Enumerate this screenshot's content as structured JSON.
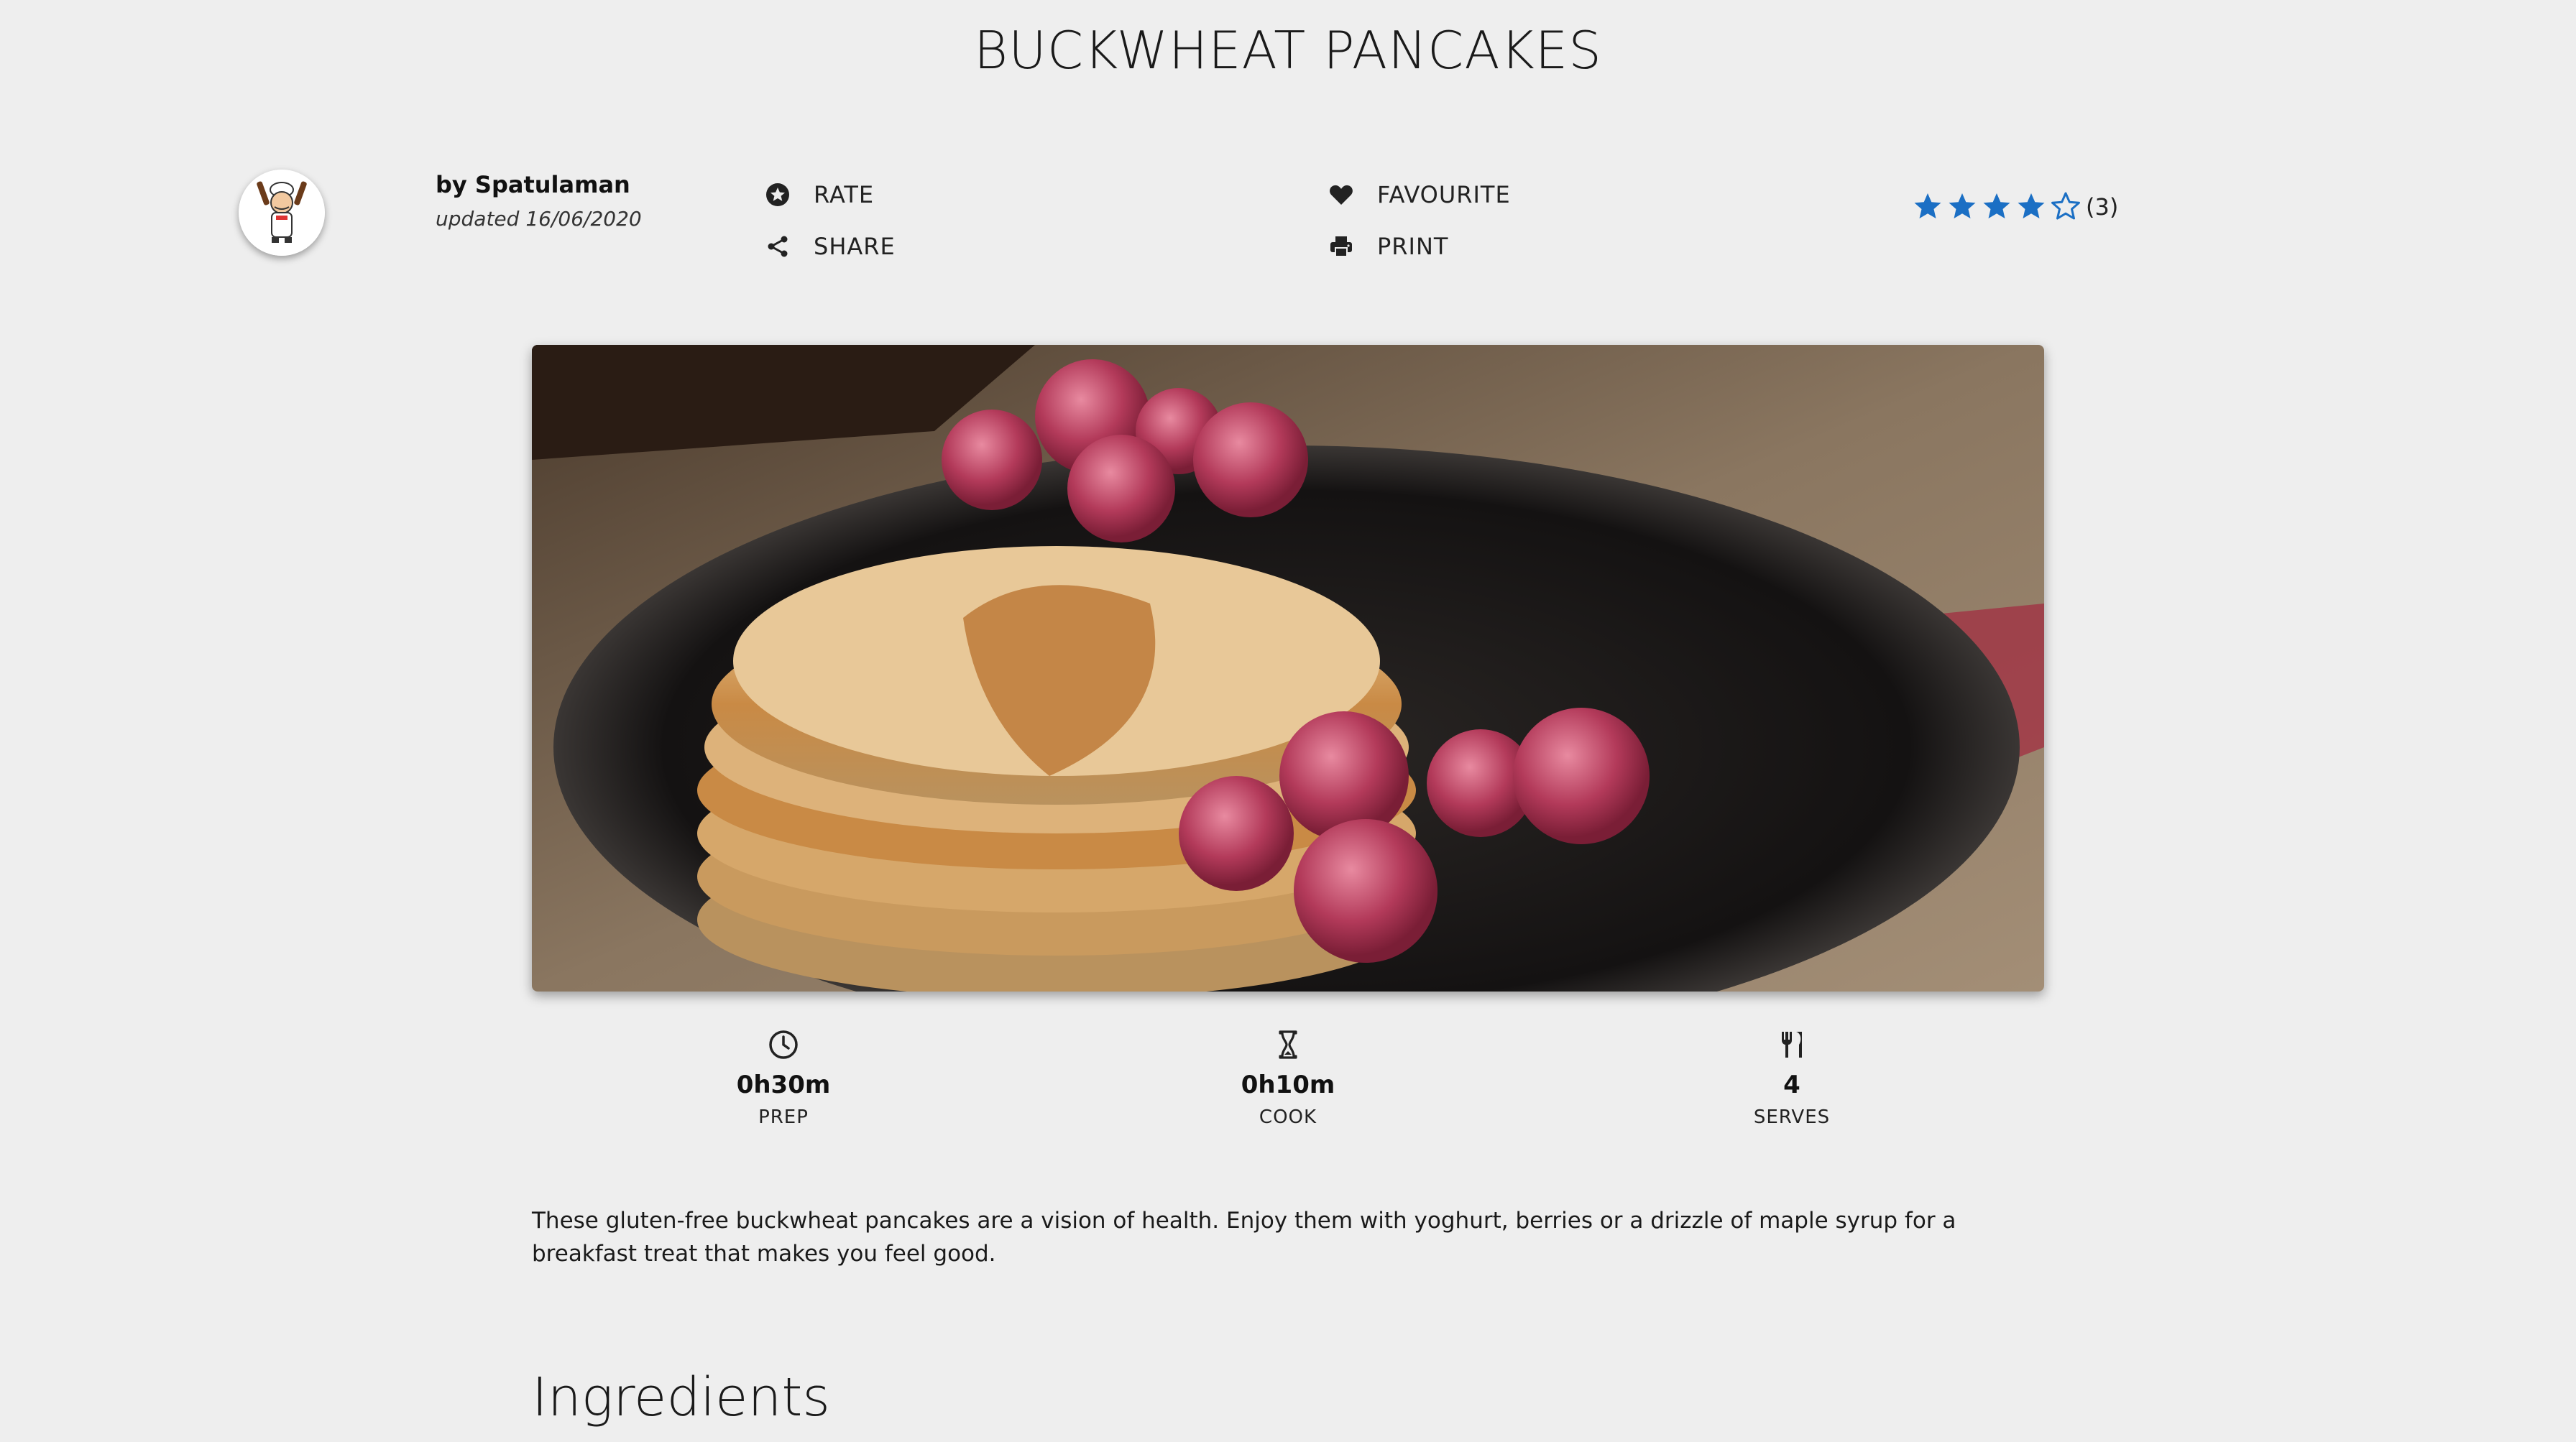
{
  "recipe": {
    "title": "BUCKWHEAT PANCAKES",
    "author": "by Spatulaman",
    "updated": "updated 16/06/2020",
    "description": "These gluten-free buckwheat pancakes are a vision of health. Enjoy them with yoghurt, berries or a drizzle of maple syrup for a breakfast treat that makes you feel good."
  },
  "actions": {
    "rate": "RATE",
    "share": "SHARE",
    "favourite": "FAVOURITE",
    "print": "PRINT"
  },
  "rating": {
    "value": 4,
    "max": 5,
    "count_label": "(3)",
    "star_color": "#1b6fc4"
  },
  "stats": {
    "prep": {
      "value": "0h30m",
      "label": "PREP",
      "icon": "clock-icon"
    },
    "cook": {
      "value": "0h10m",
      "label": "COOK",
      "icon": "hourglass-icon"
    },
    "serves": {
      "value": "4",
      "label": "SERVES",
      "icon": "cutlery-icon"
    }
  },
  "sections": {
    "ingredients_heading": "Ingredients"
  }
}
